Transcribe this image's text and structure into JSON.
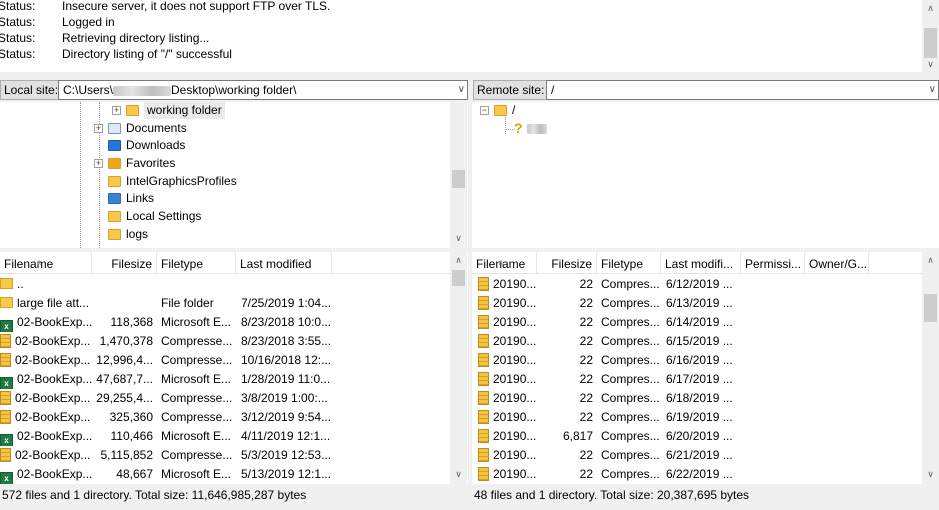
{
  "log": {
    "rows": [
      {
        "label": "Status:",
        "text": "Insecure server, it does not support FTP over TLS."
      },
      {
        "label": "Status:",
        "text": "Logged in"
      },
      {
        "label": "Status:",
        "text": "Retrieving directory listing..."
      },
      {
        "label": "Status:",
        "text": "Directory listing of \"/\" successful"
      }
    ]
  },
  "local": {
    "site_label": "Local site:",
    "path_prefix": "C:\\Users\\",
    "path_suffix": "Desktop\\working folder\\",
    "tree": [
      {
        "label": "working folder",
        "icon": "folder-icon"
      },
      {
        "label": "Documents",
        "icon": "documents-icon"
      },
      {
        "label": "Downloads",
        "icon": "downloads-icon"
      },
      {
        "label": "Favorites",
        "icon": "favorites-icon"
      },
      {
        "label": "IntelGraphicsProfiles",
        "icon": "folder-icon"
      },
      {
        "label": "Links",
        "icon": "links-icon"
      },
      {
        "label": "Local Settings",
        "icon": "folder-icon"
      },
      {
        "label": "logs",
        "icon": "folder-icon"
      }
    ],
    "columns": [
      "Filename",
      "Filesize",
      "Filetype",
      "Last modified"
    ],
    "files": [
      {
        "name": "..",
        "size": "",
        "type": "",
        "modified": "",
        "icon": "folder"
      },
      {
        "name": "large file att...",
        "size": "",
        "type": "File folder",
        "modified": "7/25/2019 1:04...",
        "icon": "folder"
      },
      {
        "name": "02-BookExp...",
        "size": "118,368",
        "type": "Microsoft E...",
        "modified": "8/23/2018 10:0...",
        "icon": "xls"
      },
      {
        "name": "02-BookExp...",
        "size": "1,470,378",
        "type": "Compresse...",
        "modified": "8/23/2018 3:55...",
        "icon": "zip"
      },
      {
        "name": "02-BookExp...",
        "size": "12,996,4...",
        "type": "Compresse...",
        "modified": "10/16/2018 12:...",
        "icon": "zip"
      },
      {
        "name": "02-BookExp...",
        "size": "47,687,7...",
        "type": "Microsoft E...",
        "modified": "1/28/2019 11:0...",
        "icon": "xls"
      },
      {
        "name": "02-BookExp...",
        "size": "29,255,4...",
        "type": "Compresse...",
        "modified": "3/8/2019 1:00:...",
        "icon": "zip"
      },
      {
        "name": "02-BookExp...",
        "size": "325,360",
        "type": "Compresse...",
        "modified": "3/12/2019 9:54...",
        "icon": "zip"
      },
      {
        "name": "02-BookExp...",
        "size": "110,466",
        "type": "Microsoft E...",
        "modified": "4/11/2019 12:1...",
        "icon": "xls"
      },
      {
        "name": "02-BookExp...",
        "size": "5,115,852",
        "type": "Compresse...",
        "modified": "5/3/2019 12:53...",
        "icon": "zip"
      },
      {
        "name": "02-BookExp...",
        "size": "48,667",
        "type": "Microsoft E...",
        "modified": "5/13/2019 12:1...",
        "icon": "xls"
      }
    ],
    "status": "572 files and 1 directory. Total size: 11,646,985,287 bytes"
  },
  "remote": {
    "site_label": "Remote site:",
    "path": "/",
    "tree": [
      {
        "label": "/",
        "icon": "folder-icon"
      },
      {
        "label": "",
        "icon": "question-icon"
      }
    ],
    "columns": [
      "Filename",
      "Filesize",
      "Filetype",
      "Last modifi...",
      "Permissi...",
      "Owner/G..."
    ],
    "files": [
      {
        "name": "20190...",
        "size": "22",
        "type": "Compres...",
        "modified": "6/12/2019 ..."
      },
      {
        "name": "20190...",
        "size": "22",
        "type": "Compres...",
        "modified": "6/13/2019 ..."
      },
      {
        "name": "20190...",
        "size": "22",
        "type": "Compres...",
        "modified": "6/14/2019 ..."
      },
      {
        "name": "20190...",
        "size": "22",
        "type": "Compres...",
        "modified": "6/15/2019 ..."
      },
      {
        "name": "20190...",
        "size": "22",
        "type": "Compres...",
        "modified": "6/16/2019 ..."
      },
      {
        "name": "20190...",
        "size": "22",
        "type": "Compres...",
        "modified": "6/17/2019 ..."
      },
      {
        "name": "20190...",
        "size": "22",
        "type": "Compres...",
        "modified": "6/18/2019 ..."
      },
      {
        "name": "20190...",
        "size": "22",
        "type": "Compres...",
        "modified": "6/19/2019 ..."
      },
      {
        "name": "20190...",
        "size": "6,817",
        "type": "Compres...",
        "modified": "6/20/2019 ..."
      },
      {
        "name": "20190...",
        "size": "22",
        "type": "Compres...",
        "modified": "6/21/2019 ..."
      },
      {
        "name": "20190...",
        "size": "22",
        "type": "Compres...",
        "modified": "6/22/2019 ..."
      }
    ],
    "status": "48 files and 1 directory. Total size: 20,387,695 bytes"
  }
}
